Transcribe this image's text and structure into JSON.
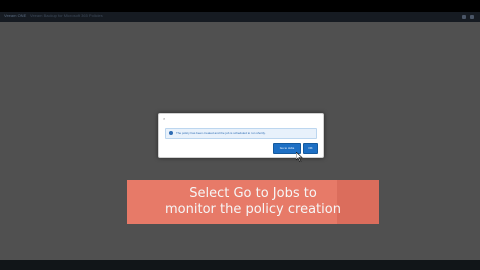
{
  "top_bar": {
    "title": "Veeam ONE",
    "tab": "Veeam Backup for Microsoft 365 Policies"
  },
  "dialog": {
    "close_label": "×",
    "info_message": "The policy has been created and the job is scheduled to run shortly.",
    "go_to_jobs_label": "Go to Jobs",
    "ok_label": "OK"
  },
  "caption": {
    "line1": "Select Go to Jobs to",
    "line2": "monitor the policy creation"
  },
  "colors": {
    "workspace": "#505050",
    "caption": "#f07d6a",
    "primary_button": "#1d6fc4"
  }
}
